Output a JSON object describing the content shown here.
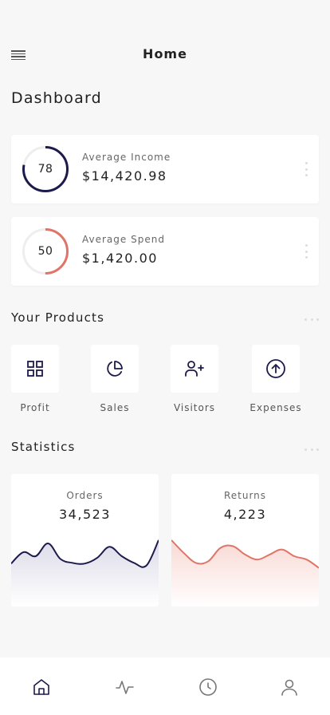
{
  "header": {
    "title": "Home"
  },
  "page_title": "Dashboard",
  "cards": [
    {
      "label": "Average Income",
      "value": "$14,420.98",
      "ring_value": "78",
      "percent": 78,
      "color": "#1d1a4c"
    },
    {
      "label": "Average Spend",
      "value": "$1,420.00",
      "ring_value": "50",
      "percent": 50,
      "color": "#e07468"
    }
  ],
  "products": {
    "title": "Your Products",
    "items": [
      {
        "label": "Profit",
        "icon": "grid-icon"
      },
      {
        "label": "Sales",
        "icon": "pie-chart-icon"
      },
      {
        "label": "Visitors",
        "icon": "add-user-icon"
      },
      {
        "label": "Expenses",
        "icon": "arrow-up-circle-icon"
      }
    ]
  },
  "statistics": {
    "title": "Statistics",
    "charts": [
      {
        "label": "Orders",
        "value": "34,523",
        "color": "#1d1a4c",
        "fill": "#dcdbe8",
        "series": [
          0.28,
          0.62,
          0.5,
          0.88,
          0.42,
          0.3,
          0.28,
          0.45,
          0.78,
          0.5,
          0.3,
          0.22,
          0.98
        ]
      },
      {
        "label": "Returns",
        "value": "4,223",
        "color": "#e07468",
        "fill": "#f9d9d4",
        "series": [
          0.98,
          0.6,
          0.3,
          0.35,
          0.75,
          0.8,
          0.55,
          0.4,
          0.55,
          0.7,
          0.5,
          0.4,
          0.15
        ]
      }
    ]
  },
  "nav": [
    {
      "name": "home",
      "icon": "home-icon",
      "active": true
    },
    {
      "name": "activity",
      "icon": "activity-icon",
      "active": false
    },
    {
      "name": "history",
      "icon": "clock-icon",
      "active": false
    },
    {
      "name": "profile",
      "icon": "user-icon",
      "active": false
    }
  ],
  "colors": {
    "accent": "#1d1a4c",
    "secondary": "#e07468",
    "track": "#eeeeee",
    "icon": "#1d1a4c",
    "nav_icon": "#777777"
  }
}
